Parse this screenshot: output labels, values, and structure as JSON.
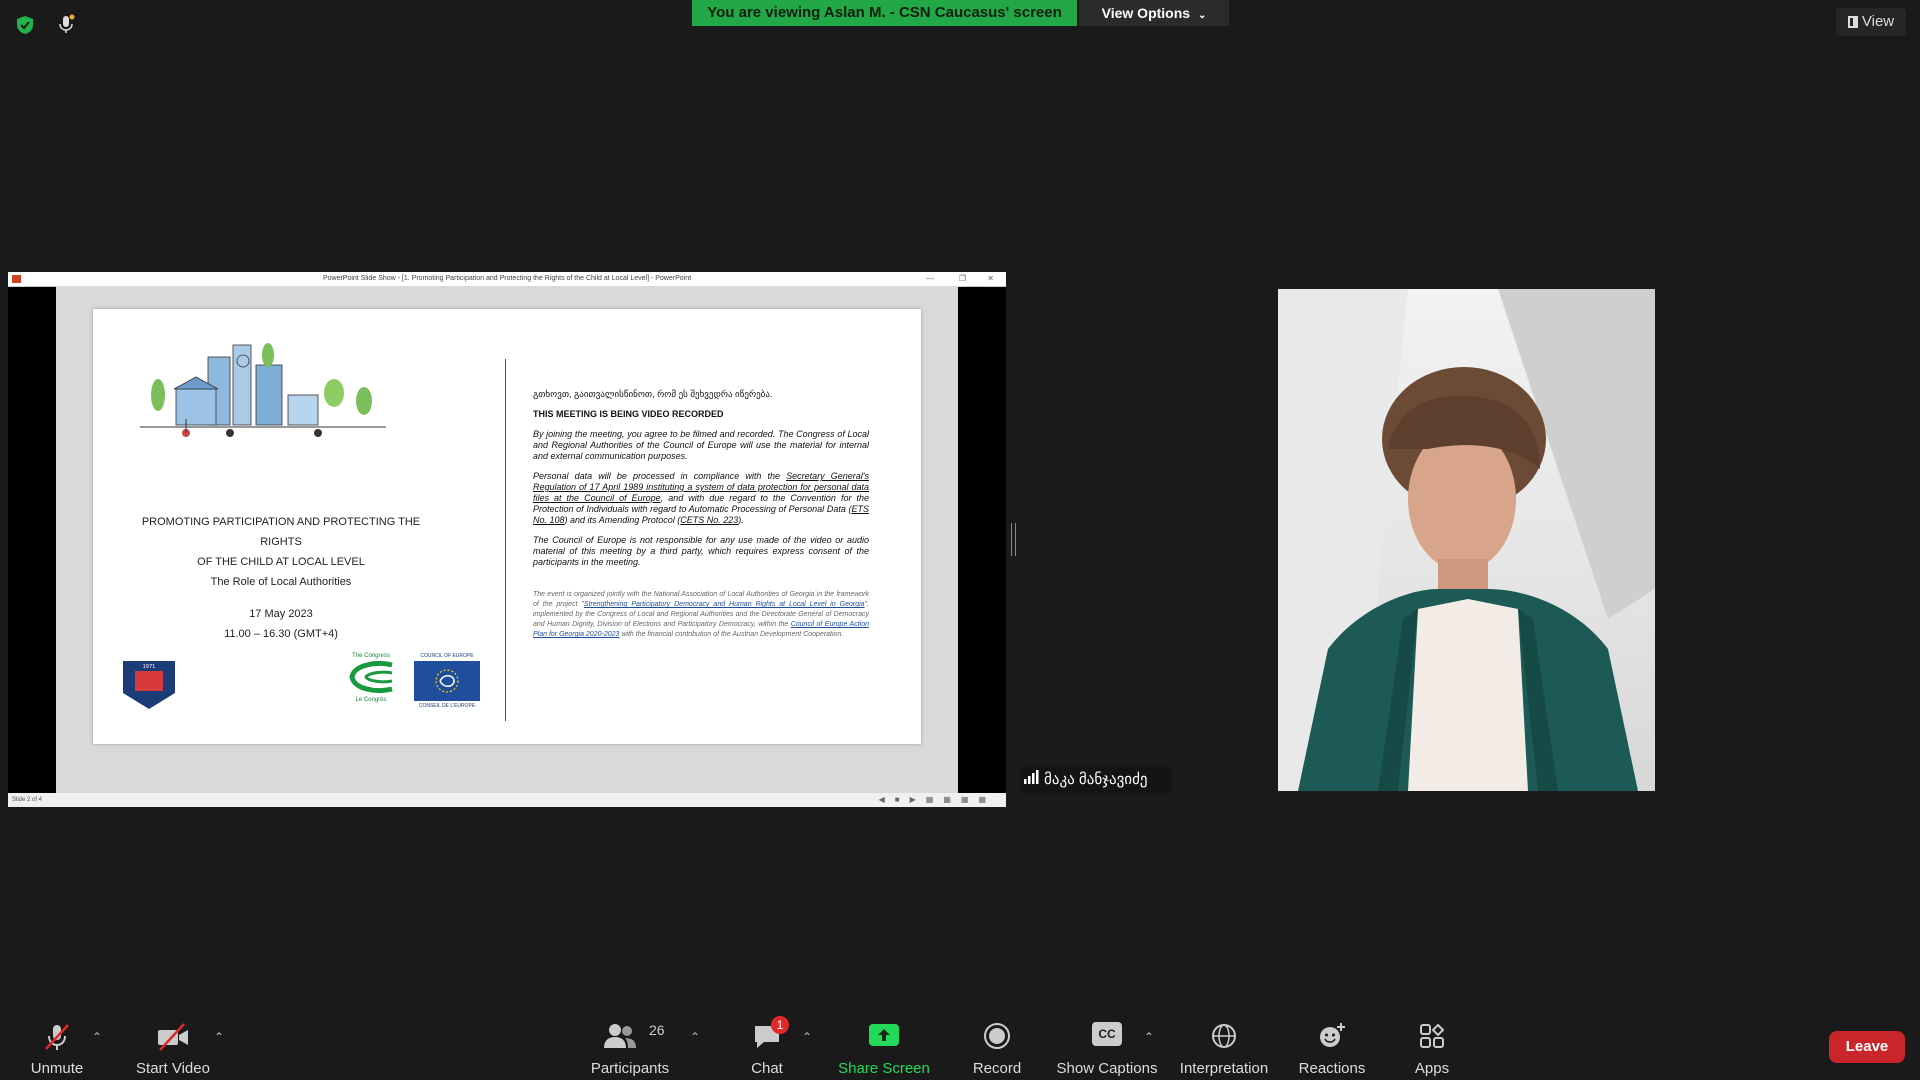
{
  "topbar": {
    "viewing_text": "You are viewing Aslan M. - CSN Caucasus' screen",
    "view_options": "View Options",
    "view_button": "View"
  },
  "share": {
    "window_title": "PowerPoint Slide Show - [1. Promoting Participation and Protecting the Rights of the Child at Local Level] - PowerPoint",
    "status_text": "Slide 2 of 4",
    "slide": {
      "title_line1": "PROMOTING PARTICIPATION AND PROTECTING THE RIGHTS",
      "title_line2": "OF THE CHILD AT LOCAL LEVEL",
      "subtitle": "The Role of Local Authorities",
      "date": "17 May 2023",
      "time": "11.00 – 16.30 (GMT+4)",
      "georgian_notice": "გთხოვთ, გაითვალისწინოთ, რომ ეს შეხვედრა იწერება.",
      "recorded_heading": "THIS MEETING IS BEING VIDEO RECORDED",
      "para1": "By joining the meeting, you agree to be filmed and recorded. The Congress of Local and Regional Authorities of the Council of Europe will use the material for internal and external communication purposes.",
      "para2_a": "Personal data will be processed in compliance with the ",
      "para2_link": "Secretary General's Regulation of 17 April 1989 instituting a system of data protection for personal data files at the Council of Europe",
      "para2_b": ", and with due regard to the Convention for the Protection of Individuals with regard to Automatic Processing of Personal Data (",
      "para2_ets108": "ETS No. 108",
      "para2_c": ") and its Amending Protocol (",
      "para2_cets223": "CETS No. 223",
      "para2_d": ").",
      "para3": "The Council of Europe is not responsible for any use made of the video or audio material of this meeting by a third party, which requires express consent of the participants in the meeting.",
      "footnote_a": "The event is organized jointly with the National Association of Local Authorities of Georgia in the framework of the project \"",
      "footnote_link1": "Strengthening Participatory Democracy and Human Rights at Local Level in Georgia",
      "footnote_b": "\", implemented by the Congress of Local and Regional Authorities and the Directorate General of Democracy and Human Dignity, Division of Elections and Participatory Democracy, within the ",
      "footnote_link2": "Council of Europe Action Plan for Georgia 2020-2023",
      "footnote_c": " with the financial contribution of the Austrian Development Cooperation.",
      "logo_congress_top": "The Congress",
      "logo_congress_bottom": "Le Congrès",
      "logo_coe_top": "COUNCIL OF EUROPE",
      "logo_coe_bottom": "CONSEIL DE L'EUROPE"
    }
  },
  "participant": {
    "name": "მაკა მანჯავიძე"
  },
  "toolbar": {
    "unmute": "Unmute",
    "start_video": "Start Video",
    "participants": "Participants",
    "participants_count": "26",
    "chat": "Chat",
    "chat_badge": "1",
    "share_screen": "Share Screen",
    "record": "Record",
    "captions": "Show Captions",
    "captions_icon_text": "CC",
    "interpretation": "Interpretation",
    "reactions": "Reactions",
    "apps": "Apps",
    "leave": "Leave"
  },
  "colors": {
    "banner_green": "#22a846",
    "share_green": "#23d959",
    "leave_red": "#c9252b",
    "background": "#1a1a1a"
  }
}
